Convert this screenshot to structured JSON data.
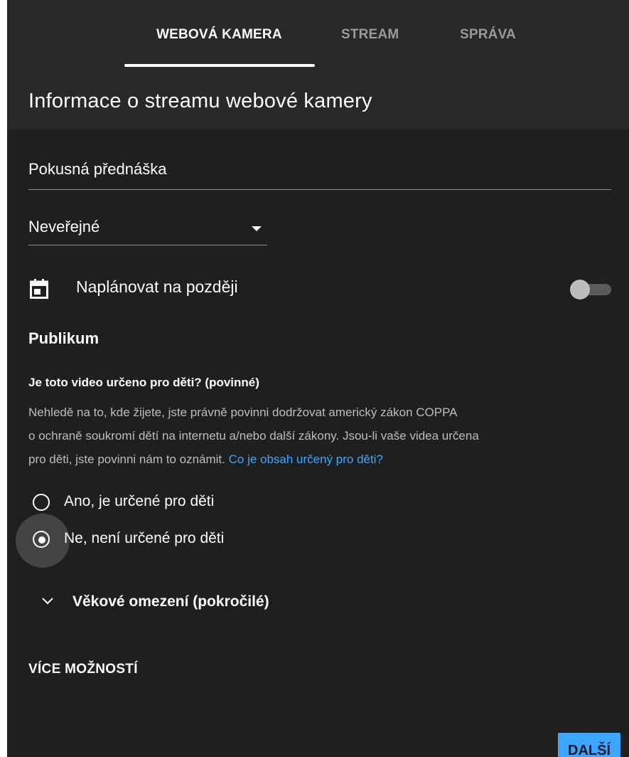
{
  "tabs": {
    "webcam": "WEBOVÁ KAMERA",
    "stream": "STREAM",
    "manage": "SPRÁVA"
  },
  "header": {
    "title": "Informace o streamu webové kamery"
  },
  "form": {
    "stream_title": "Pokusná přednáška",
    "visibility": "Neveřejné",
    "schedule_label": "Naplánovat na později",
    "schedule_enabled": false
  },
  "audience": {
    "heading": "Publikum",
    "question": "Je toto video určeno pro děti? (povinné)",
    "description_line1": "Nehledě na to, kde žijete, jste právně povinni dodržovat americký zákon COPPA",
    "description_line2": "o ochraně soukromí dětí na internetu a/nebo další zákony. Jsou-li vaše videa určena",
    "description_line3": "pro děti, jste povinni nám to oznámit.",
    "description_link": "Co je obsah určený pro děti?",
    "option_yes": "Ano, je určené pro děti",
    "option_no": "Ne, není určené pro děti",
    "selected": "no",
    "age_restriction": "Věkové omezení (pokročilé)"
  },
  "footer": {
    "more_options": "VÍCE MOŽNOSTÍ",
    "next_label": "DALŠÍ"
  },
  "colors": {
    "background": "#1f1f1f",
    "header_background": "#282828",
    "accent": "#3ea6ff",
    "inactive_tab": "#9a9a9a"
  }
}
